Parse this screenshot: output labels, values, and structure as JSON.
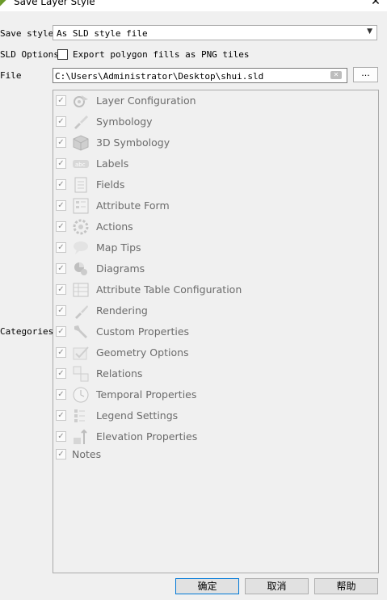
{
  "window": {
    "title": "Save Layer Style",
    "close_glyph": "✕"
  },
  "save_style": {
    "label": "Save style",
    "value": "As SLD style file"
  },
  "sld_options": {
    "label": "SLD Options",
    "checkbox_label": "Export polygon fills as PNG tiles",
    "checked": false
  },
  "file": {
    "label": "File",
    "value": "C:\\Users\\Administrator\\Desktop\\shui.sld",
    "browse_label": "..."
  },
  "categories": {
    "label": "Categories",
    "items": [
      {
        "label": "Layer Configuration",
        "icon": "layer-config-icon",
        "checked": true
      },
      {
        "label": "Symbology",
        "icon": "symbology-brush-icon",
        "checked": true
      },
      {
        "label": "3D Symbology",
        "icon": "cube-icon",
        "checked": true
      },
      {
        "label": "Labels",
        "icon": "labels-abc-icon",
        "checked": true
      },
      {
        "label": "Fields",
        "icon": "fields-icon",
        "checked": true
      },
      {
        "label": "Attribute Form",
        "icon": "form-icon",
        "checked": true
      },
      {
        "label": "Actions",
        "icon": "actions-gear-icon",
        "checked": true
      },
      {
        "label": "Map Tips",
        "icon": "speech-bubble-icon",
        "checked": true
      },
      {
        "label": "Diagrams",
        "icon": "pie-chart-icon",
        "checked": true
      },
      {
        "label": "Attribute Table Configuration",
        "icon": "table-icon",
        "checked": true
      },
      {
        "label": "Rendering",
        "icon": "paintbrush-icon",
        "checked": true
      },
      {
        "label": "Custom Properties",
        "icon": "wrench-icon",
        "checked": true
      },
      {
        "label": "Geometry Options",
        "icon": "geometry-check-icon",
        "checked": true
      },
      {
        "label": "Relations",
        "icon": "relations-icon",
        "checked": true
      },
      {
        "label": "Temporal Properties",
        "icon": "clock-icon",
        "checked": true
      },
      {
        "label": "Legend Settings",
        "icon": "legend-icon",
        "checked": true
      },
      {
        "label": "Elevation Properties",
        "icon": "elevation-icon",
        "checked": true
      },
      {
        "label": "Notes",
        "icon": "",
        "checked": true
      }
    ]
  },
  "buttons": {
    "ok": "确定",
    "cancel": "取消",
    "help": "帮助"
  }
}
